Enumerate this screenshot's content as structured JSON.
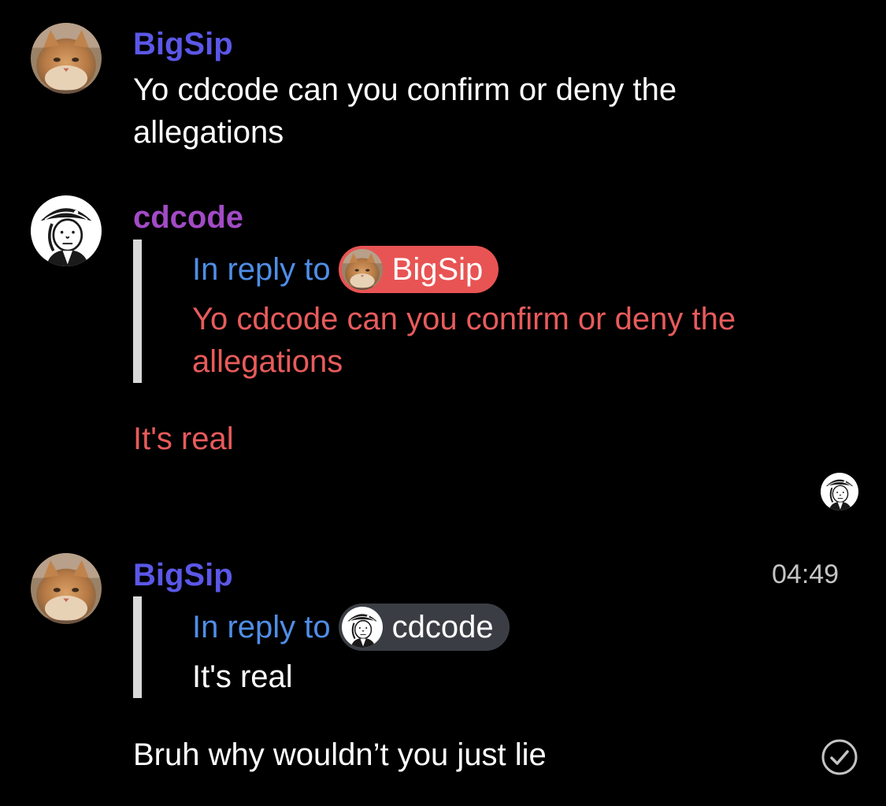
{
  "colors": {
    "bigsip_name": "#5b57e8",
    "cdcode_name": "#a24bc6",
    "reply_prefix": "#4f8ee6",
    "alert_red": "#e85b5b",
    "pill_red": "#e85454",
    "pill_dark": "#3a3e44",
    "timestamp": "#c4c4c4"
  },
  "messages": [
    {
      "author": "BigSip",
      "avatar": "cat-avatar-icon",
      "lines": [
        "Yo cdcode can you confirm or deny the",
        "allegations"
      ]
    },
    {
      "author": "cdcode",
      "avatar": "pirate-avatar-icon",
      "reply": {
        "prefix": "In reply to",
        "to": "BigSip",
        "quote_lines": [
          "Yo cdcode can you confirm or deny the",
          "allegations"
        ]
      },
      "text": "It's real"
    },
    {
      "author": "BigSip",
      "avatar": "cat-avatar-icon",
      "timestamp": "04:49",
      "reply": {
        "prefix": "In reply to",
        "to": "cdcode",
        "quote_lines": [
          "It's real"
        ]
      },
      "text": "Bruh why wouldn’t you just lie"
    }
  ]
}
